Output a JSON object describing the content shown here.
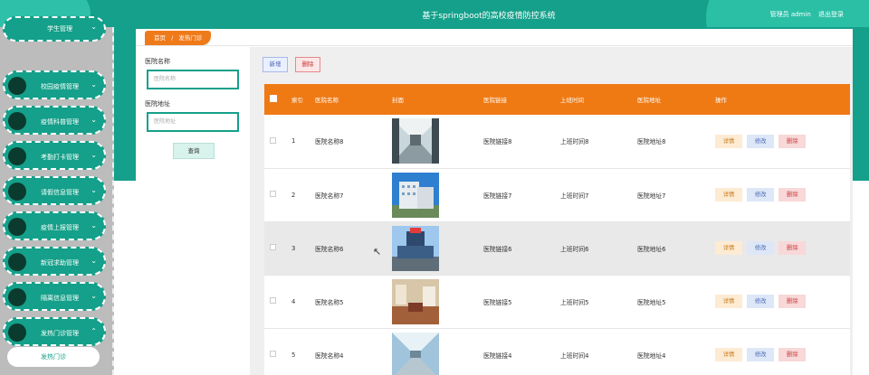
{
  "header": {
    "title": "基于springboot的高校疫情防控系统",
    "user": "管理员 admin",
    "logout": "退出登录"
  },
  "sidebar": {
    "top_item": "学生管理",
    "items": [
      {
        "label": "校园疫情管理",
        "icon": "chevron-down-icon"
      },
      {
        "label": "疫情科普管理",
        "icon": "chevron-down-icon"
      },
      {
        "label": "考勤打卡管理",
        "icon": "chevron-down-icon"
      },
      {
        "label": "请假信息管理",
        "icon": "chevron-down-icon"
      },
      {
        "label": "疫情上报管理",
        "icon": "chevron-down-icon"
      },
      {
        "label": "新冠求助管理",
        "icon": "chevron-down-icon"
      },
      {
        "label": "隔离信息管理",
        "icon": "chevron-down-icon"
      },
      {
        "label": "发热门诊管理",
        "icon": "chevron-up-icon"
      }
    ],
    "sub_item": "发热门诊"
  },
  "breadcrumb": {
    "home": "首页",
    "sep": "/",
    "current": "发热门诊"
  },
  "search": {
    "name_label": "医院名称",
    "name_placeholder": "医院名称",
    "addr_label": "医院地址",
    "addr_placeholder": "医院地址",
    "query_label": "查询"
  },
  "toolbar": {
    "new_label": "新增",
    "delete_label": "删除"
  },
  "table": {
    "headers": [
      "索引",
      "医院名称",
      "封面",
      "医院链接",
      "上班时间",
      "医院地址",
      "操作"
    ],
    "action_labels": {
      "detail": "详情",
      "edit": "修改",
      "delete": "删除"
    },
    "rows": [
      {
        "index": "1",
        "name": "医院名称8",
        "link": "医院链接8",
        "time": "上班时间8",
        "addr": "医院地址8"
      },
      {
        "index": "2",
        "name": "医院名称7",
        "link": "医院链接7",
        "time": "上班时间7",
        "addr": "医院地址7"
      },
      {
        "index": "3",
        "name": "医院名称6",
        "link": "医院链接6",
        "time": "上班时间6",
        "addr": "医院地址6"
      },
      {
        "index": "4",
        "name": "医院名称5",
        "link": "医院链接5",
        "time": "上班时间5",
        "addr": "医院地址5"
      },
      {
        "index": "5",
        "name": "医院名称4",
        "link": "医院链接4",
        "time": "上班时间4",
        "addr": "医院地址4"
      }
    ]
  },
  "colors": {
    "primary": "#14a08a",
    "accent": "#ef7a14",
    "sidebar": "#bcbcbc"
  }
}
